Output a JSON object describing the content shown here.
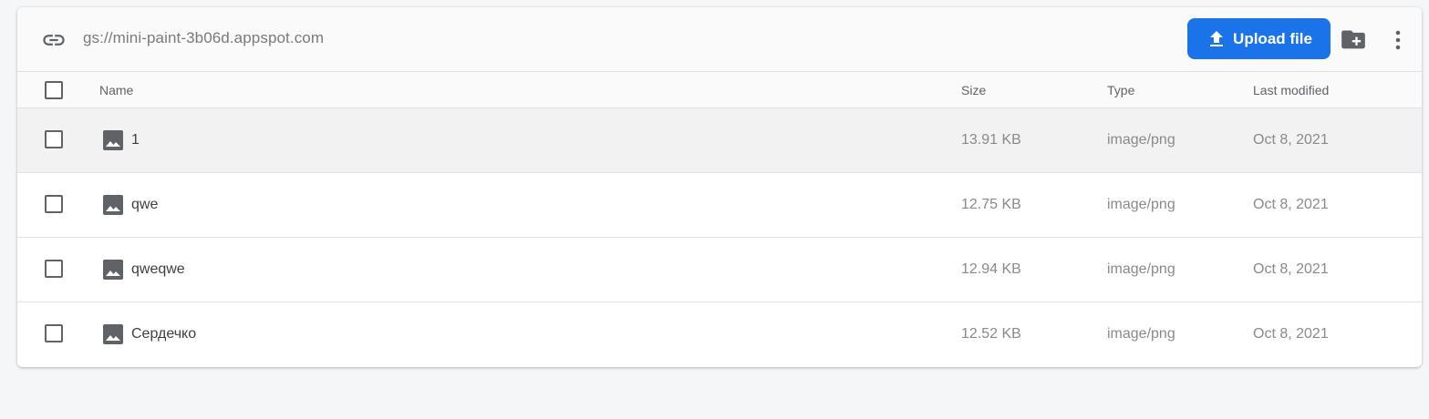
{
  "toolbar": {
    "bucket_path": "gs://mini-paint-3b06d.appspot.com",
    "upload_label": "Upload file",
    "link_icon": "link-icon",
    "upload_icon": "upload-icon",
    "new_folder_icon": "create-new-folder-icon",
    "more_icon": "more-vert-icon"
  },
  "table": {
    "columns": {
      "name": "Name",
      "size": "Size",
      "type": "Type",
      "modified": "Last modified"
    },
    "rows": [
      {
        "name": "1",
        "size": "13.91 KB",
        "type": "image/png",
        "modified": "Oct 8, 2021",
        "icon": "image-icon"
      },
      {
        "name": "qwe",
        "size": "12.75 KB",
        "type": "image/png",
        "modified": "Oct 8, 2021",
        "icon": "image-icon"
      },
      {
        "name": "qweqwe",
        "size": "12.94 KB",
        "type": "image/png",
        "modified": "Oct 8, 2021",
        "icon": "image-icon"
      },
      {
        "name": "Сердечко",
        "size": "12.52 KB",
        "type": "image/png",
        "modified": "Oct 8, 2021",
        "icon": "image-icon"
      }
    ]
  },
  "colors": {
    "accent": "#1a73e8",
    "icon_gray": "#5f6368",
    "hover_row": "#f2f2f2"
  }
}
